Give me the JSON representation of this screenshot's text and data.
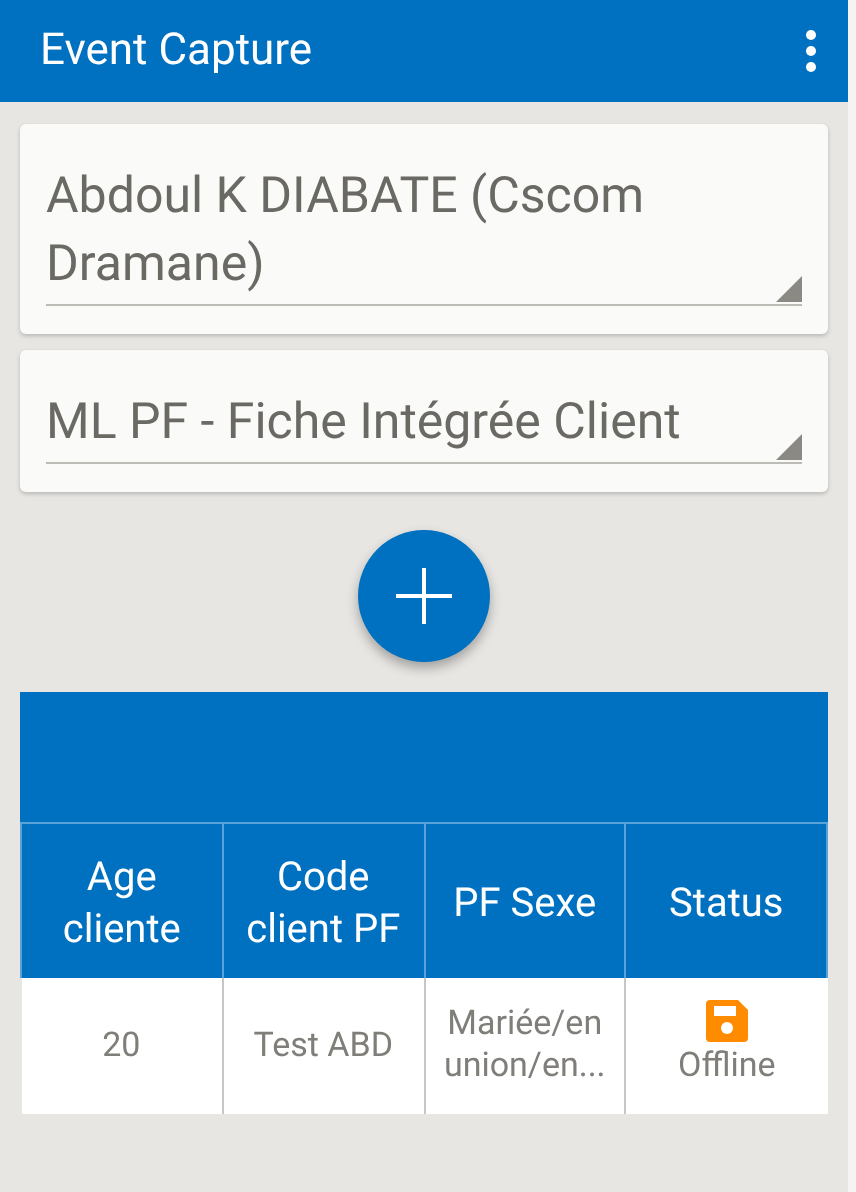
{
  "app_bar": {
    "title": "Event Capture"
  },
  "selectors": [
    {
      "value": "Abdoul K DIABATE (Cscom Dramane)"
    },
    {
      "value": "ML PF - Fiche Intégrée Client"
    }
  ],
  "table": {
    "columns": [
      "Age cliente",
      "Code client PF",
      "PF Sexe",
      "Status"
    ],
    "rows": [
      {
        "cells": [
          "20",
          "Test ABD",
          "Mariée/en union/en..."
        ],
        "status": {
          "kind": "offline",
          "label": "Offline"
        }
      }
    ]
  }
}
